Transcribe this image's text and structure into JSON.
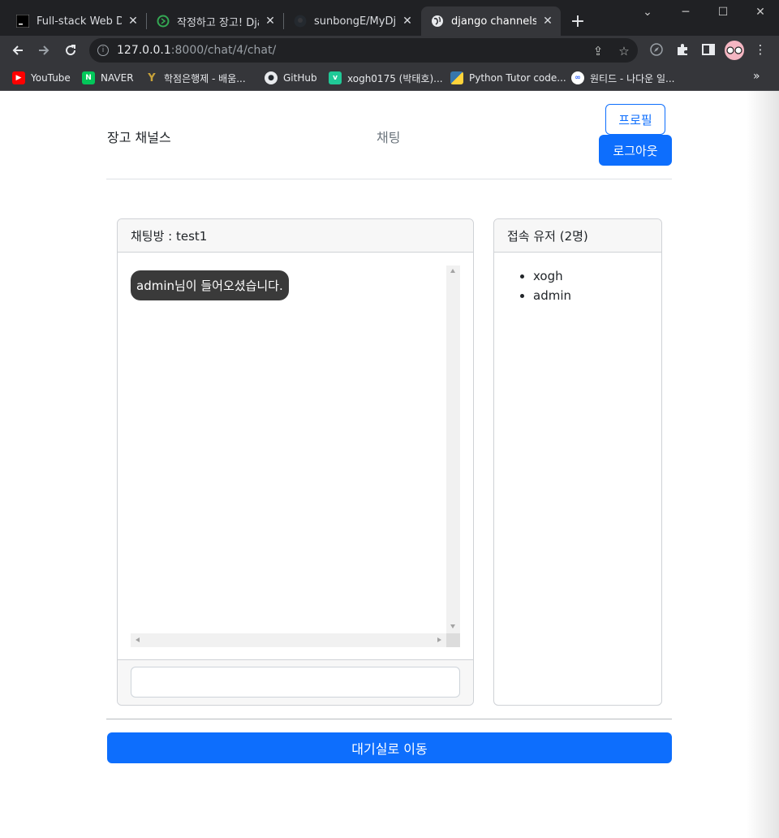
{
  "browser": {
    "tabs": [
      {
        "title": "Full-stack Web Dev",
        "icon": "terminal-icon",
        "active": false
      },
      {
        "title": "작정하고 장고! Djan",
        "icon": "django-icon",
        "active": false
      },
      {
        "title": "sunbongE/MyDjang",
        "icon": "github-icon",
        "active": false
      },
      {
        "title": "django channels",
        "icon": "globe-icon",
        "active": true
      }
    ],
    "new_tab": "+",
    "url_host": "127.0.0.1",
    "url_path": ":8000/chat/4/chat/",
    "bookmarks": [
      {
        "label": "YouTube",
        "icon_text": "▶",
        "color": "#ff0000"
      },
      {
        "label": "NAVER",
        "icon_text": "N",
        "color": "#03c75a"
      },
      {
        "label": "학점은행제 - 배움...",
        "icon_text": "Y",
        "color": "#8a7a2a"
      },
      {
        "label": "GitHub",
        "icon_text": "●",
        "color": "#24292f"
      },
      {
        "label": "xogh0175 (박태호)...",
        "icon_text": "v",
        "color": "#20c997"
      },
      {
        "label": "Python Tutor code...",
        "icon_text": "Py",
        "color": "#3776ab"
      },
      {
        "label": "원티드 - 나다운 일...",
        "icon_text": "w",
        "color": "#3366ff"
      }
    ],
    "more_bookmarks": "»"
  },
  "page": {
    "brand": "장고 채널스",
    "nav_chat": "채팅",
    "profile_button": "프로필",
    "logout_button": "로그아웃",
    "chat_room_title": "채팅방 : test1",
    "messages": [
      "admin님이 들어오셨습니다."
    ],
    "message_input_value": "",
    "users_title": "접속 유저 (2명)",
    "users": [
      "xogh",
      "admin"
    ],
    "lobby_button": "대기실로 이동"
  },
  "colors": {
    "primary": "#0d6efd",
    "bubble": "#3a3a3a"
  }
}
